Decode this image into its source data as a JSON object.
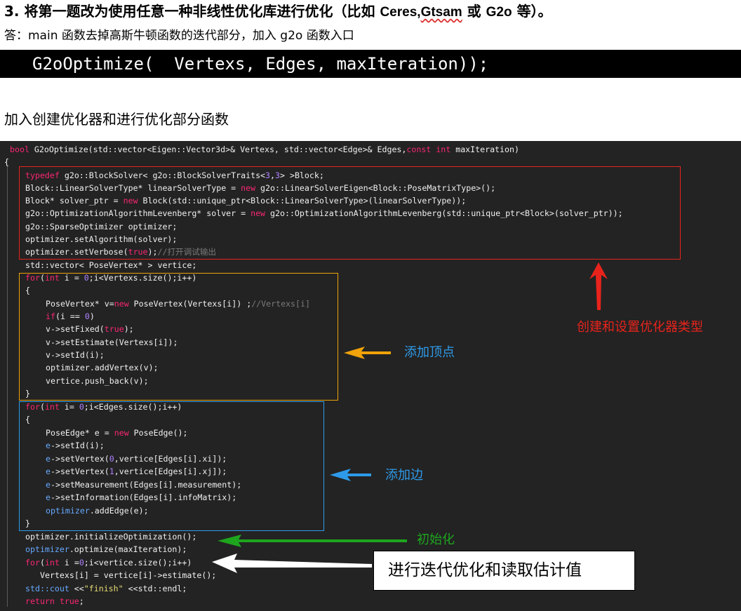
{
  "heading": {
    "num": "3.",
    "text1": "将第一题改为使用任意一种非线性优化库进行优化（比如",
    "ceres": "Ceres,",
    "gtsam": "Gtsam",
    "or": "或",
    "g2o": "G2o",
    "text2": "等）。"
  },
  "answer": "答：main 函数去掉高斯牛顿函数的迭代部分，加入 g2o 函数入口",
  "call_code": "G2oOptimize(  Vertexs, Edges, maxIteration));",
  "subheading": "加入创建优化器和进行优化部分函数",
  "code": {
    "l0_bool": "bool",
    "l0_a": " G2oOptimize(std::vector<Eigen::Vector3d>& Vertexs, std::vector<Edge>& Edges,",
    "l0_const": "const",
    "l0_int": "int",
    "l0_b": " maxIteration)",
    "l1": "{",
    "l2_typedef": "typedef",
    "l2_a": " g2o::BlockSolver< g2o::BlockSolverTraits<",
    "l2_n1": "3",
    "l2_comma": ",",
    "l2_n2": "3",
    "l2_b": "> >Block;",
    "l3_a": "Block::LinearSolverType* linearSolverType = ",
    "l3_new": "new",
    "l3_b": " g2o::LinearSolverEigen<Block::PoseMatrixType>();",
    "l4_a": "Block* solver_ptr = ",
    "l4_new": "new",
    "l4_b": " Block(std::unique_ptr<Block::LinearSolverType>(linearSolverType));",
    "l5_a": "g2o::OptimizationAlgorithmLevenberg* solver = ",
    "l5_new": "new",
    "l5_b": " g2o::OptimizationAlgorithmLevenberg(std::unique_ptr<Block>(solver_ptr));",
    "l6": "g2o::SparseOptimizer optimizer;",
    "l7": "optimizer.setAlgorithm(solver);",
    "l8_a": "optimizer.setVerbose(",
    "l8_true": "true",
    "l8_b": ");",
    "l8_cm": "//打开调试输出",
    "l9": "std::vector< PoseVertex* > vertice;",
    "l10_for": "for",
    "l10_p": "(",
    "l10_int": "int",
    "l10_a": " i = ",
    "l10_n": "0",
    "l10_b": ";i<Vertexs.size();i++)",
    "l11": "{",
    "l12_a": "PoseVertex* v=",
    "l12_new": "new",
    "l12_b": " PoseVertex(Vertexs[i]) ;",
    "l12_cm": "//Vertexs[i]",
    "l13_if": "if",
    "l13_a": "(i == ",
    "l13_n": "0",
    "l13_b": ")",
    "l14_a": "v->setFixed(",
    "l14_true": "true",
    "l14_b": ");",
    "l15": "v->setEstimate(Vertexs[i]);",
    "l16": "v->setId(i);",
    "l17": "optimizer.addVertex(v);",
    "l18": "vertice.push_back(v);",
    "l19": "}",
    "l20_for": "for",
    "l20_p": "(",
    "l20_int": "int",
    "l20_a": " i= ",
    "l20_n": "0",
    "l20_b": ";i<Edges.size();i++)",
    "l21": "{",
    "l22_a": "PoseEdge* e = ",
    "l22_new": "new",
    "l22_b": " PoseEdge();",
    "l23_e": "e",
    "l23_b": "->setId(i);",
    "l24_e": "e",
    "l24_a": "->setVertex(",
    "l24_n": "0",
    "l24_b": ",vertice[Edges[i].xi]);",
    "l25_e": "e",
    "l25_a": "->setVertex(",
    "l25_n": "1",
    "l25_b": ",vertice[Edges[i].xj]);",
    "l26_e": "e",
    "l26_b": "->setMeasurement(Edges[i].measurement);",
    "l27_e": "e",
    "l27_b": "->setInformation(Edges[i].infoMatrix);",
    "l28_opt": "optimizer",
    "l28_b": ".addEdge(e);",
    "l29": "}",
    "l30": "optimizer.initializeOptimization();",
    "l31_opt": "optimizer",
    "l31_b": ".optimize(maxIteration);",
    "l32_for": "for",
    "l32_p": "(",
    "l32_int": "int",
    "l32_a": " i =",
    "l32_n": "0",
    "l32_b": ";i<vertice.size();i++)",
    "l33": "Vertexs[i] = vertice[i]->estimate();",
    "l34_std": "std::",
    "l34_cout": "cout",
    "l34_a": " <<",
    "l34_str": "\"finish\"",
    "l34_b": " <<std::endl;",
    "l35_ret": "return",
    "l35_true": " true",
    "l35_b": ";"
  },
  "annotations": {
    "red": "创建和设置优化器类型",
    "orange": "添加顶点",
    "blue": "添加边",
    "green": "初始化",
    "callout": "进行迭代优化和读取估计值"
  },
  "colors": {
    "red": "#e8231c",
    "orange": "#f0a30a",
    "blue": "#2e9bea",
    "green": "#1ea51e"
  }
}
